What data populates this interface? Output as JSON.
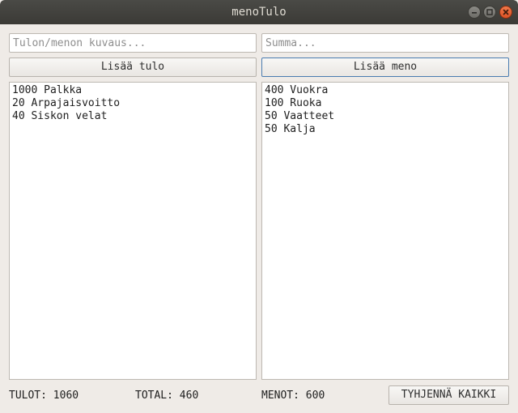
{
  "window": {
    "title": "menoTulo"
  },
  "inputs": {
    "description_placeholder": "Tulon/menon kuvaus...",
    "amount_placeholder": "Summa...",
    "description_value": "",
    "amount_value": ""
  },
  "buttons": {
    "add_income": "Lisää tulo",
    "add_expense": "Lisää meno",
    "clear_all": "TYHJENNÄ KAIKKI"
  },
  "income_list": [
    "1000 Palkka",
    "20 Arpajaisvoitto",
    "40 Siskon velat"
  ],
  "expense_list": [
    "400 Vuokra",
    "100 Ruoka",
    "50 Vaatteet",
    "50 Kalja"
  ],
  "totals": {
    "income": "TULOT: 1060",
    "total": "TOTAL: 460",
    "expenses": "MENOT: 600"
  },
  "icons": {
    "minimize": "minimize-icon",
    "maximize": "maximize-icon",
    "close": "close-icon"
  }
}
